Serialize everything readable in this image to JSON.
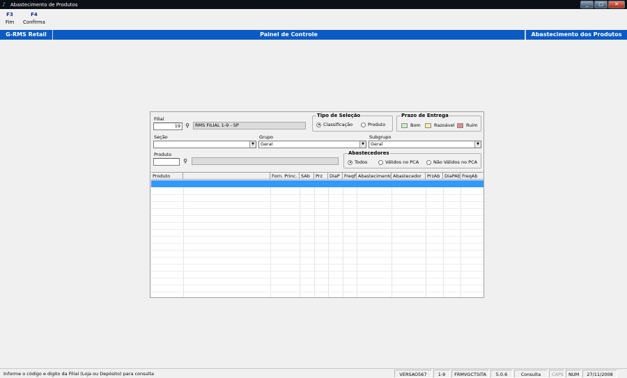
{
  "window": {
    "title": "Abastecimento de Produtos",
    "controls": [
      "_",
      "□",
      "✕"
    ]
  },
  "toolbar": [
    {
      "key": "F3",
      "label": "Fim"
    },
    {
      "key": "F4",
      "label": "Confirma"
    }
  ],
  "header": {
    "left": "G-RMS Retail",
    "center": "Painel de Controle",
    "right": "Abastecimento dos Produtos"
  },
  "form": {
    "filial": {
      "label": "Filial",
      "value": "19",
      "description": "RMS FILIAL 1-9 - SP"
    },
    "secao": {
      "label": "Seção",
      "value": ""
    },
    "grupo": {
      "label": "Grupo",
      "value": "Geral"
    },
    "subgrupo": {
      "label": "Subgrupo",
      "value": "Geral"
    },
    "produto": {
      "label": "Produto",
      "value": "",
      "description": ""
    },
    "tipo_selecao": {
      "title": "Tipo de Seleção",
      "options": [
        "Classificação",
        "Produto"
      ],
      "selected": "Classificação"
    },
    "prazo_entrega": {
      "title": "Prazo de Entrega",
      "items": [
        {
          "label": "Bom",
          "color": "#c8f0c0"
        },
        {
          "label": "Razoável",
          "color": "#f5f0a8"
        },
        {
          "label": "Ruim",
          "color": "#e88a8a"
        }
      ]
    },
    "abastecedores": {
      "title": "Abastecedores",
      "options": [
        "Todos",
        "Válidos no PCA",
        "Não Válidos no PCA"
      ],
      "selected": "Todos"
    }
  },
  "grid": {
    "columns": [
      "Produto",
      "",
      "Forn. Princ.",
      "SAb",
      "Prz",
      "DiaP",
      "FreqF",
      "Abastecimento",
      "Abastecedor",
      "PrzAb",
      "DiaPAb",
      "FreqAb"
    ],
    "selected_color": "#3399ff"
  },
  "statusbar": {
    "message": "Informe o código e digito da Filial (Loja ou Depósito) para consulta",
    "panels": [
      "VERSAO567",
      "1-9",
      "FRMVGCTSITA",
      "5.0.6",
      "Consulta",
      "CAPS",
      "NUM",
      "27/11/2008"
    ]
  }
}
